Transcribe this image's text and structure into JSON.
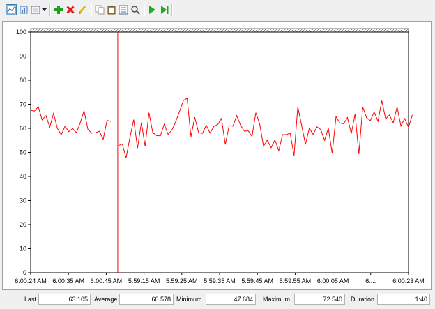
{
  "toolbar": {
    "buttons": [
      {
        "id": "view-graph",
        "icon": "graph-view-icon",
        "pressed": true
      },
      {
        "id": "view-histogram",
        "icon": "histogram-view-icon"
      },
      {
        "id": "change-graph-type",
        "icon": "change-graph-type-icon",
        "dropdown": true
      },
      {
        "id": "add",
        "icon": "plus-icon"
      },
      {
        "id": "delete",
        "icon": "delete-x-icon"
      },
      {
        "id": "highlight",
        "icon": "highlighter-pencil-icon"
      },
      {
        "id": "copy-properties",
        "icon": "copy-icon"
      },
      {
        "id": "paste-counter-list",
        "icon": "paste-clipboard-icon"
      },
      {
        "id": "properties",
        "icon": "properties-icon"
      },
      {
        "id": "zoom",
        "icon": "magnifier-icon"
      },
      {
        "id": "unfreeze",
        "icon": "play-icon"
      },
      {
        "id": "update",
        "icon": "step-forward-icon"
      }
    ],
    "colors": {
      "plus": "#1fa01f",
      "delete": "#d42020",
      "play": "#22aa22",
      "pencil": "#d8b820"
    }
  },
  "chart_data": {
    "type": "line",
    "ylim": [
      0,
      100
    ],
    "yticks": [
      0,
      10,
      20,
      30,
      40,
      50,
      60,
      70,
      80,
      90,
      100
    ],
    "x_tick_labels": [
      "6:00:24 AM",
      "6:00:35 AM",
      "6:00:45 AM",
      "5:59:15 AM",
      "5:59:25 AM",
      "5:59:35 AM",
      "5:59:45 AM",
      "5:59:55 AM",
      "6:00:05 AM",
      "6:...",
      "6:00:23 AM"
    ],
    "sample_count": 100,
    "current_position_index": 23,
    "line_color": "#ff0000",
    "grid": false,
    "series": [
      {
        "values": [
          67.5,
          67.2,
          69.0,
          63.5,
          65.3,
          60.5,
          66.2,
          60.0,
          57.3,
          60.9,
          58.6,
          59.9,
          58.2,
          62.4,
          67.3,
          59.6,
          58.0,
          58.2,
          58.8,
          55.4,
          63.3,
          62.9,
          null,
          52.8,
          53.5,
          47.7,
          56.1,
          63.6,
          51.8,
          62.4,
          52.5,
          66.5,
          58.2,
          57.0,
          56.9,
          61.7,
          57.5,
          59.3,
          62.7,
          67.0,
          71.5,
          72.5,
          56.5,
          64.6,
          58.2,
          57.9,
          61.3,
          58.0,
          60.8,
          61.6,
          64.1,
          53.3,
          61.1,
          60.9,
          65.3,
          61.3,
          58.8,
          59.0,
          56.6,
          66.5,
          61.8,
          52.6,
          55.1,
          51.9,
          55.2,
          50.7,
          57.4,
          57.4,
          57.9,
          48.7,
          69.0,
          61.2,
          53.3,
          60.1,
          57.5,
          60.6,
          59.5,
          55.0,
          60.1,
          49.6,
          64.9,
          62.2,
          61.9,
          64.5,
          57.8,
          66.0,
          49.3,
          68.9,
          64.4,
          63.2,
          66.8,
          62.9,
          71.5,
          63.9,
          65.5,
          62.3,
          68.9,
          61.0,
          64.1,
          60.4,
          65.6
        ]
      }
    ]
  },
  "stats": {
    "last_label": "Last",
    "last_value": "63.105",
    "average_label": "Average",
    "average_value": "60.578",
    "minimum_label": "Minimum",
    "minimum_value": "47.684",
    "maximum_label": "Maximum",
    "maximum_value": "72.540",
    "duration_label": "Duration",
    "duration_value": "1:40"
  }
}
